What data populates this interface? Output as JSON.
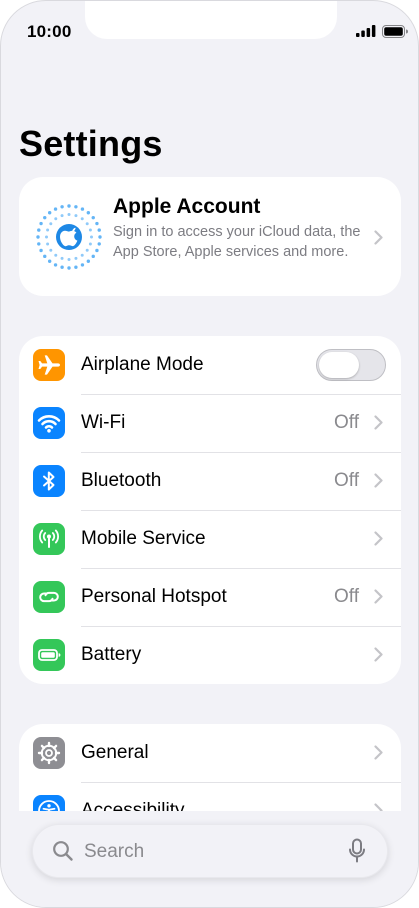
{
  "status": {
    "time": "10:00",
    "icons": [
      "cellular-signal-icon",
      "battery-icon"
    ]
  },
  "page": {
    "title": "Settings"
  },
  "account": {
    "title": "Apple Account",
    "description": "Sign in to access your iCloud data, the App Store, Apple services and more.",
    "icon": "apple-account-icon"
  },
  "group1": [
    {
      "label": "Airplane Mode",
      "value": "",
      "icon": "airplane-icon",
      "color": "#ff9500",
      "control": "toggle",
      "on": false
    },
    {
      "label": "Wi-Fi",
      "value": "Off",
      "icon": "wifi-icon",
      "color": "#0a84ff"
    },
    {
      "label": "Bluetooth",
      "value": "Off",
      "icon": "bluetooth-icon",
      "color": "#0a84ff"
    },
    {
      "label": "Mobile Service",
      "value": "",
      "icon": "antenna-icon",
      "color": "#34c759"
    },
    {
      "label": "Personal Hotspot",
      "value": "Off",
      "icon": "hotspot-icon",
      "color": "#34c759"
    },
    {
      "label": "Battery",
      "value": "",
      "icon": "battery-setting-icon",
      "color": "#34c759"
    }
  ],
  "group2": [
    {
      "label": "General",
      "icon": "gear-icon",
      "color": "#8e8e93"
    },
    {
      "label": "Accessibility",
      "icon": "accessibility-icon",
      "color": "#0a84ff"
    }
  ],
  "search": {
    "placeholder": "Search",
    "icon": "search-icon",
    "mic_icon": "microphone-icon"
  }
}
